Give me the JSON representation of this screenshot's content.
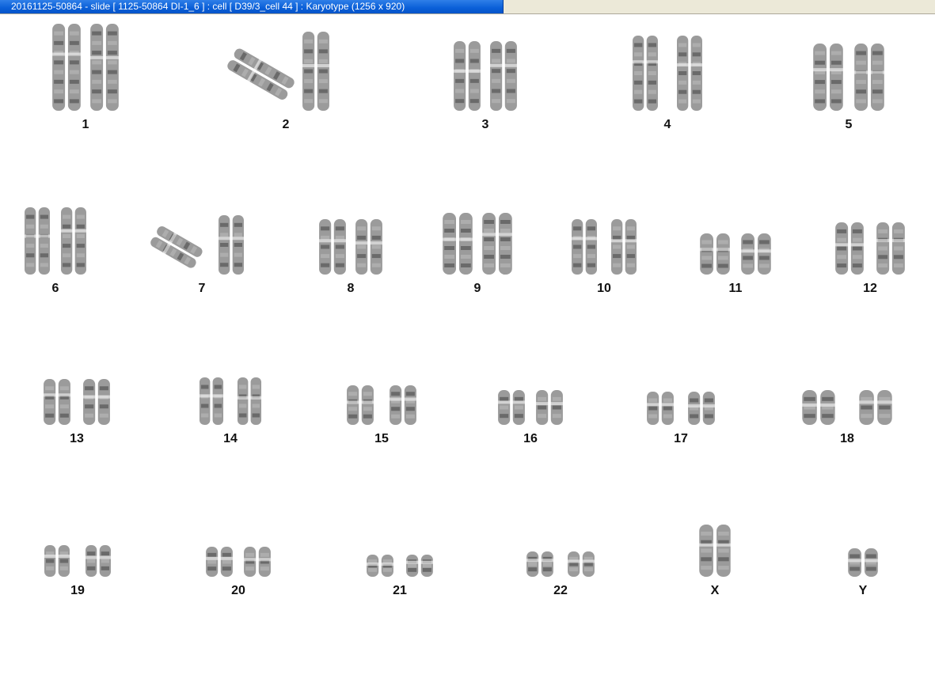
{
  "window": {
    "title": "20161125-50864 - slide [ 1125-50864 DI-1_6 ] : cell [ D39/3_cell 44 ] : Karyotype  (1256 x 920)"
  },
  "karyotype": {
    "pairs": [
      {
        "label": "1"
      },
      {
        "label": "2"
      },
      {
        "label": "3"
      },
      {
        "label": "4"
      },
      {
        "label": "5"
      },
      {
        "label": "6"
      },
      {
        "label": "7"
      },
      {
        "label": "8"
      },
      {
        "label": "9"
      },
      {
        "label": "10"
      },
      {
        "label": "11"
      },
      {
        "label": "12"
      },
      {
        "label": "13"
      },
      {
        "label": "14"
      },
      {
        "label": "15"
      },
      {
        "label": "16"
      },
      {
        "label": "17"
      },
      {
        "label": "18"
      },
      {
        "label": "19"
      },
      {
        "label": "20"
      },
      {
        "label": "21"
      },
      {
        "label": "22"
      },
      {
        "label": "X"
      },
      {
        "label": "Y"
      }
    ]
  }
}
